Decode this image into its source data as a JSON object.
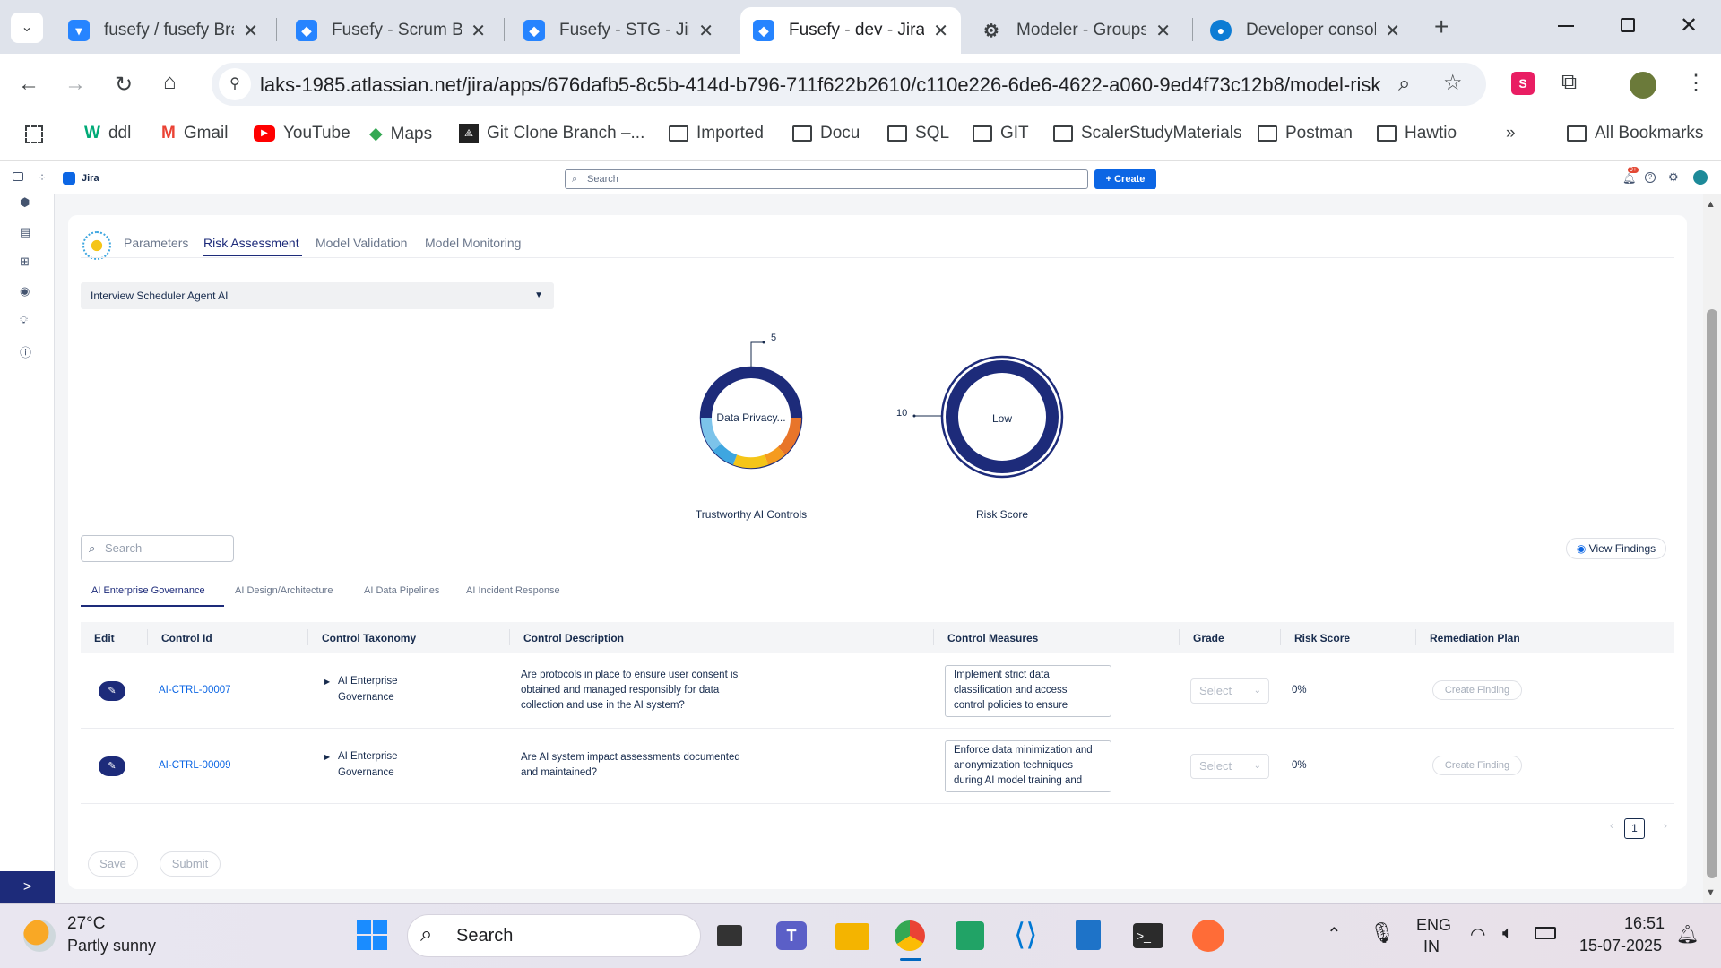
{
  "browser": {
    "tabs": [
      {
        "title": "fusefy / fusefy Bran",
        "icon": "bitbucket-icon",
        "active": false
      },
      {
        "title": "Fusefy - Scrum Boa",
        "icon": "jira-icon",
        "active": false
      },
      {
        "title": "Fusefy - STG - Jira",
        "icon": "jira-icon",
        "active": false
      },
      {
        "title": "Fusefy - dev - Jira",
        "icon": "jira-icon",
        "active": true
      },
      {
        "title": "Modeler - Groups",
        "icon": "gear-icon",
        "active": false
      },
      {
        "title": "Developer console",
        "icon": "droplet-icon",
        "active": false
      }
    ],
    "url": "laks-1985.atlassian.net/jira/apps/676dafb5-8c5b-414d-b796-711f622b2610/c110e226-6de6-4622-a060-9ed4f73c12b8/model-risk",
    "bookmarks": {
      "ddl": "ddl",
      "gmail": "Gmail",
      "youtube": "YouTube",
      "maps": "Maps",
      "git_clone": "Git Clone Branch –...",
      "imported": "Imported",
      "docu": "Docu",
      "sql": "SQL",
      "git": "GIT",
      "scaler": "ScalerStudyMaterials",
      "postman": "Postman",
      "hawtio": "Hawtio",
      "all_bookmarks": "All Bookmarks"
    }
  },
  "jira": {
    "product": "Jira",
    "search_placeholder": "Search",
    "create_label": "+ Create",
    "notification_badge": "9+"
  },
  "app": {
    "tabs": {
      "parameters": "Parameters",
      "risk_assessment": "Risk Assessment",
      "model_validation": "Model Validation",
      "model_monitoring": "Model Monitoring"
    },
    "selected_model": "Interview Scheduler Agent AI",
    "donut1": {
      "center": "Data Privacy...",
      "callout": "5",
      "caption": "Trustworthy AI Controls"
    },
    "donut2": {
      "center": "Low",
      "callout": "10",
      "caption": "Risk Score"
    },
    "search_placeholder": "Search",
    "view_findings": "View Findings",
    "subtabs": {
      "governance": "AI Enterprise Governance",
      "design": "AI Design/Architecture",
      "pipelines": "AI Data Pipelines",
      "incident": "AI Incident Response"
    },
    "columns": {
      "edit": "Edit",
      "control_id": "Control Id",
      "taxonomy": "Control Taxonomy",
      "description": "Control Description",
      "measures": "Control Measures",
      "grade": "Grade",
      "risk_score": "Risk Score",
      "remediation": "Remediation Plan"
    },
    "rows": [
      {
        "control_id": "AI-CTRL-00007",
        "taxonomy_1": "AI Enterprise",
        "taxonomy_2": "Governance",
        "desc_1": "Are protocols in place to ensure user consent is",
        "desc_2": "obtained and managed responsibly for data",
        "desc_3": "collection and use in the AI system?",
        "measure_1": "Implement strict data",
        "measure_2": "classification and access",
        "measure_3": "control policies to ensure",
        "grade": "Select",
        "risk_score": "0%",
        "remediation": "Create Finding"
      },
      {
        "control_id": "AI-CTRL-00009",
        "taxonomy_1": "AI Enterprise",
        "taxonomy_2": "Governance",
        "desc_1": "Are AI system impact assessments documented",
        "desc_2": "and maintained?",
        "desc_3": "",
        "measure_1": "Enforce data minimization and",
        "measure_2": "anonymization techniques",
        "measure_3": "during AI model training and",
        "grade": "Select",
        "risk_score": "0%",
        "remediation": "Create Finding"
      }
    ],
    "page": "1",
    "save": "Save",
    "submit": "Submit"
  },
  "taskbar": {
    "temperature": "27°C",
    "weather": "Partly sunny",
    "search": "Search",
    "lang_1": "ENG",
    "lang_2": "IN",
    "time": "16:51",
    "date": "15-07-2025"
  },
  "colors": {
    "primary": "#1d2b7a",
    "accent_blue": "#0c66e4",
    "donut_orange": "#e8752a",
    "donut_yellow": "#f5c518",
    "donut_light_blue": "#3ea6e0"
  }
}
